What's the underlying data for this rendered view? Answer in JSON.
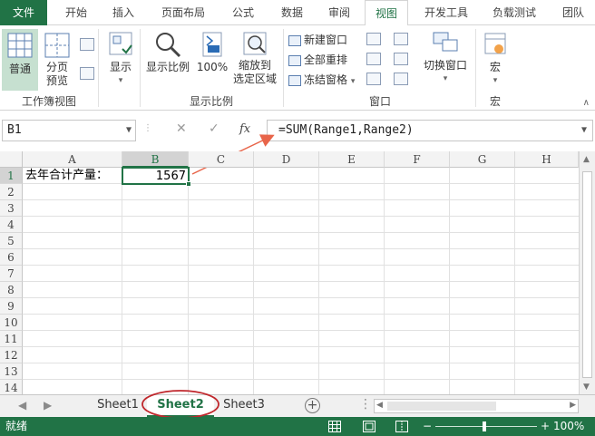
{
  "ribbon_tabs": {
    "file": "文件",
    "items": [
      "开始",
      "插入",
      "页面布局",
      "公式",
      "数据",
      "审阅",
      "视图",
      "开发工具",
      "负载测试",
      "团队"
    ],
    "active": "视图"
  },
  "ribbon": {
    "group_workbook_views": {
      "label": "工作簿视图",
      "normal": "普通",
      "page_break_line1": "分页",
      "page_break_line2": "预览"
    },
    "show": {
      "label": "显示"
    },
    "group_zoom": {
      "label": "显示比例",
      "zoom": "显示比例",
      "zoom_100": "100%",
      "zoom_selection_line1": "缩放到",
      "zoom_selection_line2": "选定区域"
    },
    "group_window": {
      "label": "窗口",
      "new_window": "新建窗口",
      "arrange_all": "全部重排",
      "freeze_panes": "冻结窗格",
      "switch_windows": "切换窗口"
    },
    "group_macros": {
      "label": "宏",
      "macros": "宏"
    }
  },
  "formula_bar": {
    "name_box": "B1",
    "cancel_icon": "✕",
    "enter_icon": "✓",
    "fx_label": "fx",
    "formula": "=SUM(Range1,Range2)"
  },
  "sheet": {
    "columns": [
      "A",
      "B",
      "C",
      "D",
      "E",
      "F",
      "G",
      "H"
    ],
    "selected_column": "B",
    "rows": [
      "1",
      "2",
      "3",
      "4",
      "5",
      "6",
      "7",
      "8",
      "9",
      "10",
      "11",
      "12",
      "13",
      "14"
    ],
    "selected_row": "1",
    "cells": {
      "A1": "去年合计产量：",
      "B1": "1567"
    },
    "annotation_color": "#e8654a",
    "selected_cell": "B1"
  },
  "sheet_tabs": {
    "tabs": [
      "Sheet1",
      "Sheet2",
      "Sheet3"
    ],
    "active": "Sheet2",
    "add_symbol": "+",
    "highlight_color": "#c0282d"
  },
  "status_bar": {
    "status": "就绪",
    "zoom_minus": "−",
    "zoom_plus": "+",
    "zoom": "100%"
  },
  "colors": {
    "accent": "#217346",
    "gridline": "#e1e1e1",
    "header_bg": "#f3f3f3"
  }
}
